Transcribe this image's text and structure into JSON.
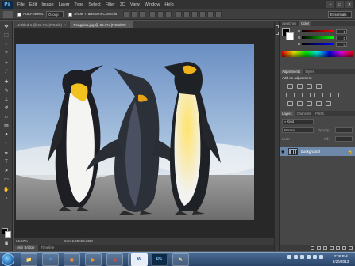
{
  "app": {
    "logo": "Ps",
    "menu": [
      "File",
      "Edit",
      "Image",
      "Layer",
      "Type",
      "Select",
      "Filter",
      "3D",
      "View",
      "Window",
      "Help"
    ],
    "window_controls": [
      "–",
      "▭",
      "✕"
    ]
  },
  "options_bar": {
    "auto_select_label": "Auto-Select:",
    "auto_select_value": "Group",
    "show_transform_label": "Show Transform Controls",
    "workspace": "Essentials"
  },
  "documents": {
    "tabs": [
      {
        "label": "Untitled-1 @ 66.7% (RGB/8)",
        "active": false
      },
      {
        "label": "Penguins.jpg @ 66.7% (RGB/8#)",
        "active": true
      }
    ],
    "close_glyph": "×"
  },
  "status": {
    "zoom": "66.67%",
    "doc_size": "Doc: 2.25M/2.25M"
  },
  "bottom_tabs": [
    "Mini Bridge",
    "Timeline"
  ],
  "panels": {
    "top_tabs": [
      "Swatches",
      "Color"
    ],
    "color_sliders": [
      {
        "label": "R",
        "value": "0"
      },
      {
        "label": "G",
        "value": "0"
      },
      {
        "label": "B",
        "value": "0"
      }
    ],
    "adjustments_tabs": [
      "Adjustments",
      "Styles"
    ],
    "adjustments_title": "Add an adjustment",
    "layers_tabs": [
      "Layers",
      "Channels",
      "Paths"
    ],
    "kind_label": "Kind",
    "blend_mode": "Normal",
    "opacity_label": "Opacity:",
    "lock_label": "Lock:",
    "fill_label": "Fill:",
    "layer_name": "Background"
  },
  "taskbar": {
    "apps": [
      {
        "name": "folder-app",
        "glyph": "📁",
        "active": false
      },
      {
        "name": "ie-app",
        "glyph": "e",
        "active": false
      },
      {
        "name": "firefox-app",
        "glyph": "◉",
        "active": false
      },
      {
        "name": "media-app",
        "glyph": "▶",
        "active": false
      },
      {
        "name": "chrome-app",
        "glyph": "◎",
        "active": false
      },
      {
        "name": "explorer-app",
        "glyph": "▦",
        "active": false
      },
      {
        "name": "word-app",
        "glyph": "W",
        "active": true
      },
      {
        "name": "photoshop-app",
        "glyph": "Ps",
        "active": true
      },
      {
        "name": "paint-app",
        "glyph": "✎",
        "active": false
      }
    ],
    "time": "2:36 PM",
    "date": "9/26/2013"
  },
  "colors": {
    "accent_blue": "#6d88a8",
    "foreground": "#000000",
    "background": "#ffffff"
  }
}
